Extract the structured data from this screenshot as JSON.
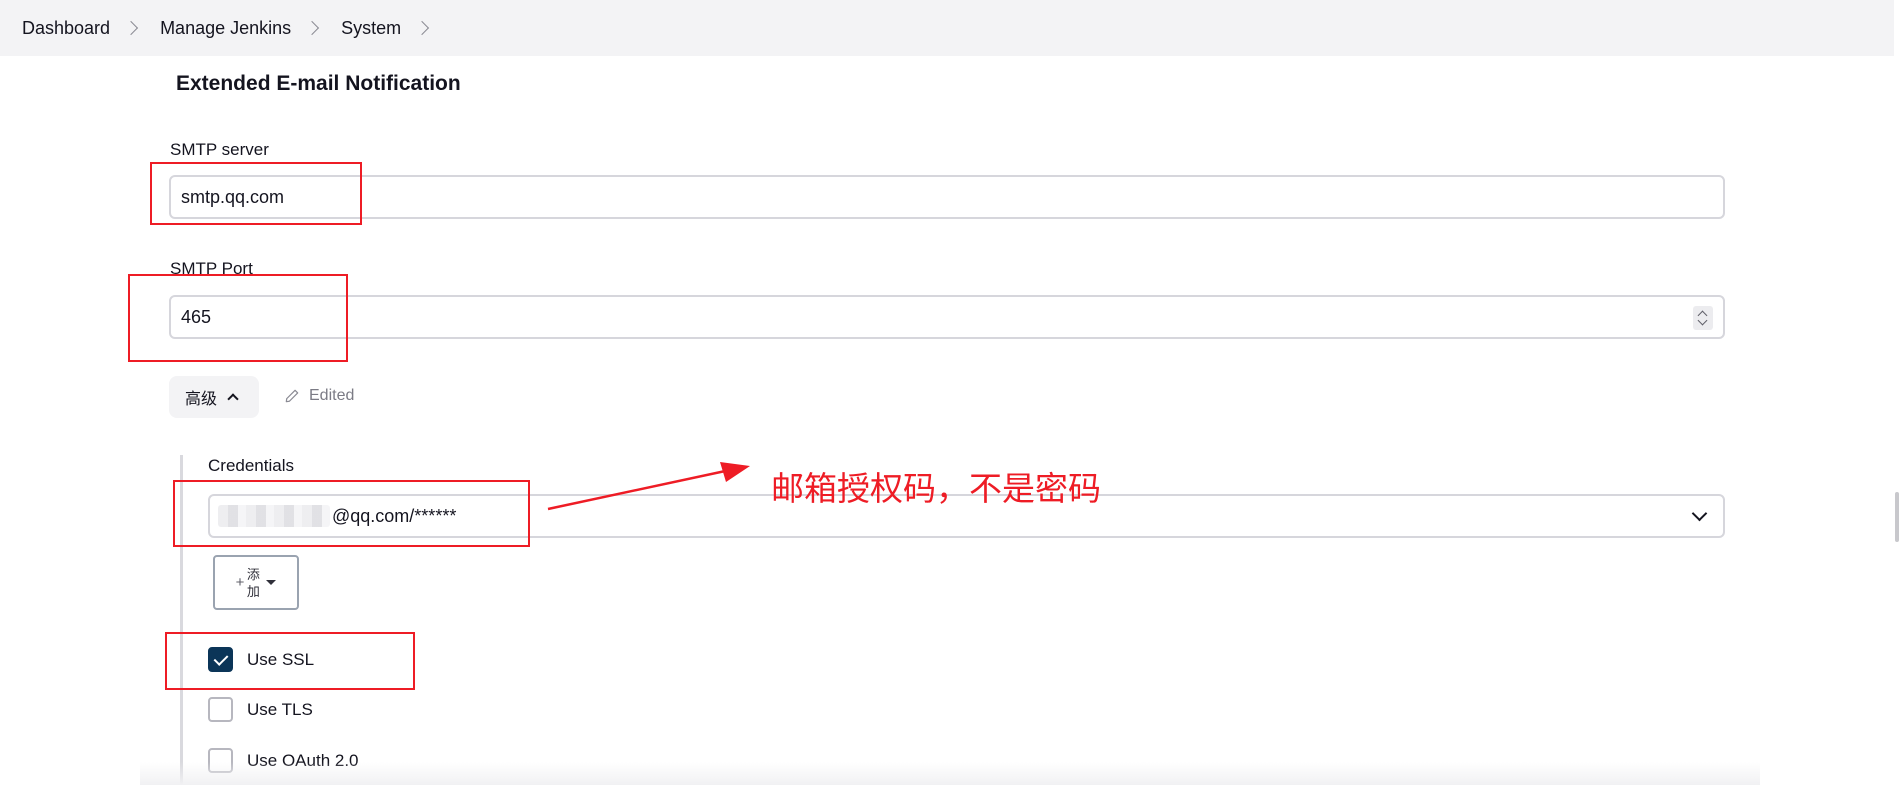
{
  "breadcrumb": {
    "items": [
      "Dashboard",
      "Manage Jenkins",
      "System"
    ]
  },
  "section": {
    "title": "Extended E-mail Notification"
  },
  "smtp_server": {
    "label": "SMTP server",
    "value": "smtp.qq.com"
  },
  "smtp_port": {
    "label": "SMTP Port",
    "value": "465"
  },
  "advanced": {
    "button_label": "高级",
    "edited_label": "Edited"
  },
  "credentials": {
    "label": "Credentials",
    "selected_value": "@qq.com/******",
    "add_button_label": "添加"
  },
  "options": [
    {
      "label": "Use SSL",
      "checked": true
    },
    {
      "label": "Use TLS",
      "checked": false
    },
    {
      "label": "Use OAuth 2.0",
      "checked": false
    }
  ],
  "annotation": {
    "text": "邮箱授权码，不是密码",
    "color": "#ee1c25"
  },
  "colors": {
    "checkbox_checked": "#0b3558",
    "breadcrumb_bg": "#f3f3f5"
  },
  "icons": {
    "breadcrumb_separator": "chevron-right-icon",
    "advanced_toggle": "chevron-up-icon",
    "edited": "pencil-icon",
    "select_dropdown": "chevron-down-icon",
    "add": "plus-icon"
  }
}
